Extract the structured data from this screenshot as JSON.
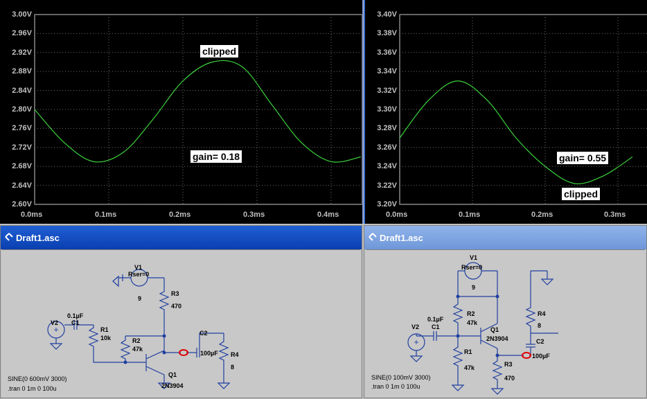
{
  "plot_left": {
    "y_ticks": [
      "3.00V",
      "2.96V",
      "2.92V",
      "2.88V",
      "2.84V",
      "2.80V",
      "2.76V",
      "2.72V",
      "2.68V",
      "2.64V",
      "2.60V"
    ],
    "x_ticks": [
      "0.0ms",
      "0.1ms",
      "0.2ms",
      "0.3ms",
      "0.4ms"
    ],
    "annotation_top": "clipped",
    "annotation_gain": "gain= 0.18"
  },
  "plot_right": {
    "y_ticks": [
      "3.40V",
      "3.38V",
      "3.36V",
      "3.34V",
      "3.32V",
      "3.30V",
      "3.28V",
      "3.26V",
      "3.24V",
      "3.22V",
      "3.20V"
    ],
    "x_ticks": [
      "0.0ms",
      "0.1ms",
      "0.2ms",
      "0.3ms"
    ],
    "annotation_gain": "gain= 0.55",
    "annotation_bottom": "clipped"
  },
  "chart_data": [
    {
      "type": "line",
      "ylim": [
        2.6,
        3.0
      ],
      "xlim": [
        0.0,
        0.45
      ],
      "x_unit": "ms",
      "y_unit": "V",
      "series": [
        {
          "x": [
            0.0,
            0.04,
            0.08,
            0.12,
            0.16,
            0.2,
            0.24,
            0.28,
            0.32,
            0.36,
            0.4,
            0.44
          ],
          "y": [
            2.8,
            2.73,
            2.69,
            2.71,
            2.78,
            2.86,
            2.9,
            2.89,
            2.81,
            2.73,
            2.69,
            2.7
          ]
        }
      ],
      "line_color": "#3cd23c"
    },
    {
      "type": "line",
      "ylim": [
        3.2,
        3.4
      ],
      "xlim": [
        0.0,
        0.32
      ],
      "x_unit": "ms",
      "y_unit": "V",
      "series": [
        {
          "x": [
            0.0,
            0.04,
            0.08,
            0.12,
            0.16,
            0.2,
            0.24,
            0.28,
            0.32
          ],
          "y": [
            3.27,
            3.31,
            3.33,
            3.31,
            3.27,
            3.24,
            3.222,
            3.23,
            3.25
          ]
        }
      ],
      "line_color": "#3cd23c"
    }
  ],
  "schematic_left": {
    "title": "Draft1.asc",
    "v1": "V1",
    "rser": "Rser=0",
    "v1_val": "9",
    "r3": "R3",
    "r3_val": "470",
    "c1_val": "0.1µF",
    "c1": "C1",
    "v2": "V2",
    "r1": "R1",
    "r1_val": "10k",
    "r2": "R2",
    "r2_val": "47k",
    "c2": "C2",
    "c2_val": "100µF",
    "r4": "R4",
    "r4_val": "8",
    "q1": "Q1",
    "q1_val": "2N3904",
    "sine": "SINE(0 600mV 3000)",
    "tran": ".tran 0 1m 0 100u"
  },
  "schematic_right": {
    "title": "Draft1.asc",
    "v1": "V1",
    "rser": "Rser=0",
    "v1_val": "9",
    "r2": "R2",
    "r2_val": "47k",
    "q1": "Q1",
    "q1_val": "2N3904",
    "r4": "R4",
    "r4_val": "8",
    "c1_val": "0.1µF",
    "c1": "C1",
    "v2": "V2",
    "c2": "C2",
    "c2_val": "100µF",
    "r1": "R1",
    "r1_val": "47k",
    "r3": "R3",
    "r3_val": "470",
    "sine": "SINE(0 100mV 3000)",
    "tran": ".tran 0 1m 0 100u"
  }
}
